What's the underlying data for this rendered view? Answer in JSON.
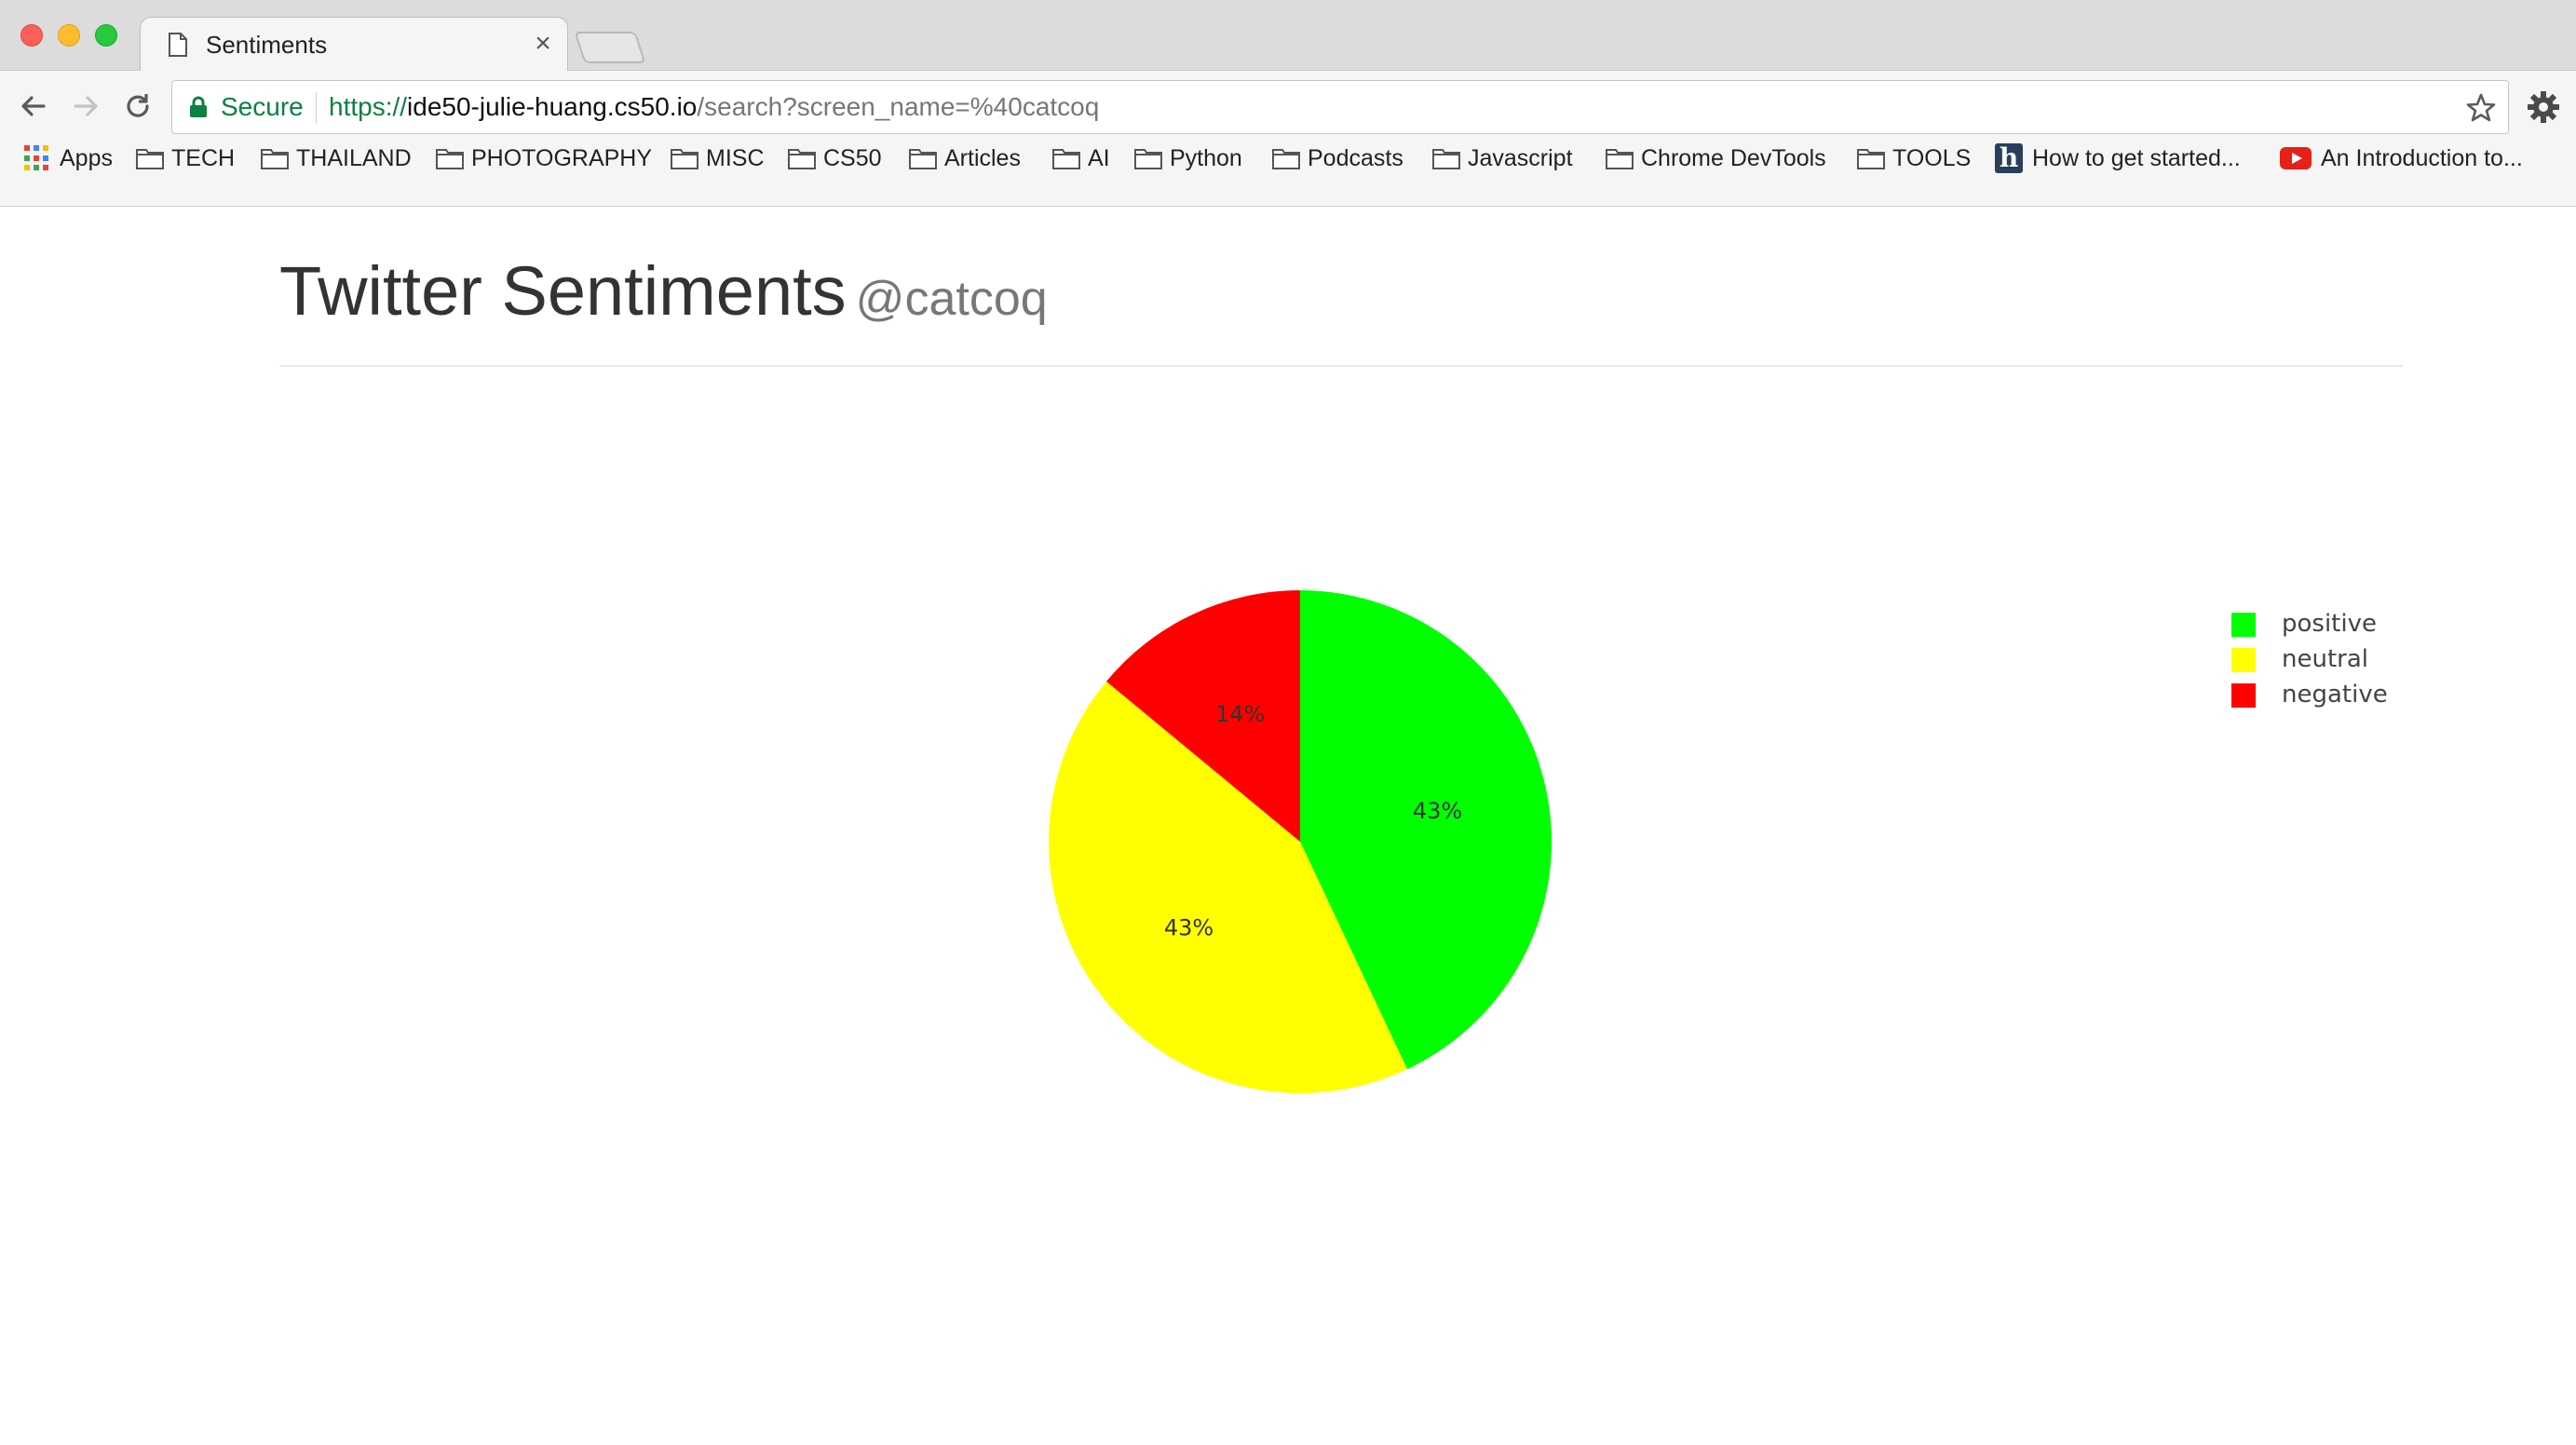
{
  "browser": {
    "tab_title": "Sentiments",
    "tab_close": "×",
    "secure_label": "Secure",
    "url_scheme": "https://",
    "url_host": "ide50-julie-huang.cs50.io",
    "url_path": "/search?screen_name=%40catcoq",
    "bookmarks": [
      {
        "label": "Apps",
        "icon": "apps-grid-icon"
      },
      {
        "label": "TECH",
        "icon": "folder-icon"
      },
      {
        "label": "THAILAND",
        "icon": "folder-icon"
      },
      {
        "label": "PHOTOGRAPHY",
        "icon": "folder-icon"
      },
      {
        "label": "MISC",
        "icon": "folder-icon"
      },
      {
        "label": "CS50",
        "icon": "folder-icon"
      },
      {
        "label": "Articles",
        "icon": "folder-icon"
      },
      {
        "label": "AI",
        "icon": "folder-icon"
      },
      {
        "label": "Python",
        "icon": "folder-icon"
      },
      {
        "label": "Podcasts",
        "icon": "folder-icon"
      },
      {
        "label": "Javascript",
        "icon": "folder-icon"
      },
      {
        "label": "Chrome DevTools",
        "icon": "folder-icon"
      },
      {
        "label": "TOOLS",
        "icon": "folder-icon"
      },
      {
        "label": "How to get started...",
        "icon": "hashnode-icon"
      },
      {
        "label": "An Introduction to...",
        "icon": "youtube-icon"
      }
    ]
  },
  "page": {
    "title": "Twitter Sentiments",
    "subtitle": "@catcoq"
  },
  "chart_data": {
    "type": "pie",
    "labels": [
      "positive",
      "neutral",
      "negative"
    ],
    "values": [
      43,
      43,
      14
    ],
    "text_labels": [
      "43%",
      "43%",
      "14%"
    ],
    "colors": [
      "#00ff00",
      "#ffff00",
      "#ff0000"
    ],
    "legend_position": "top-right",
    "title": ""
  }
}
